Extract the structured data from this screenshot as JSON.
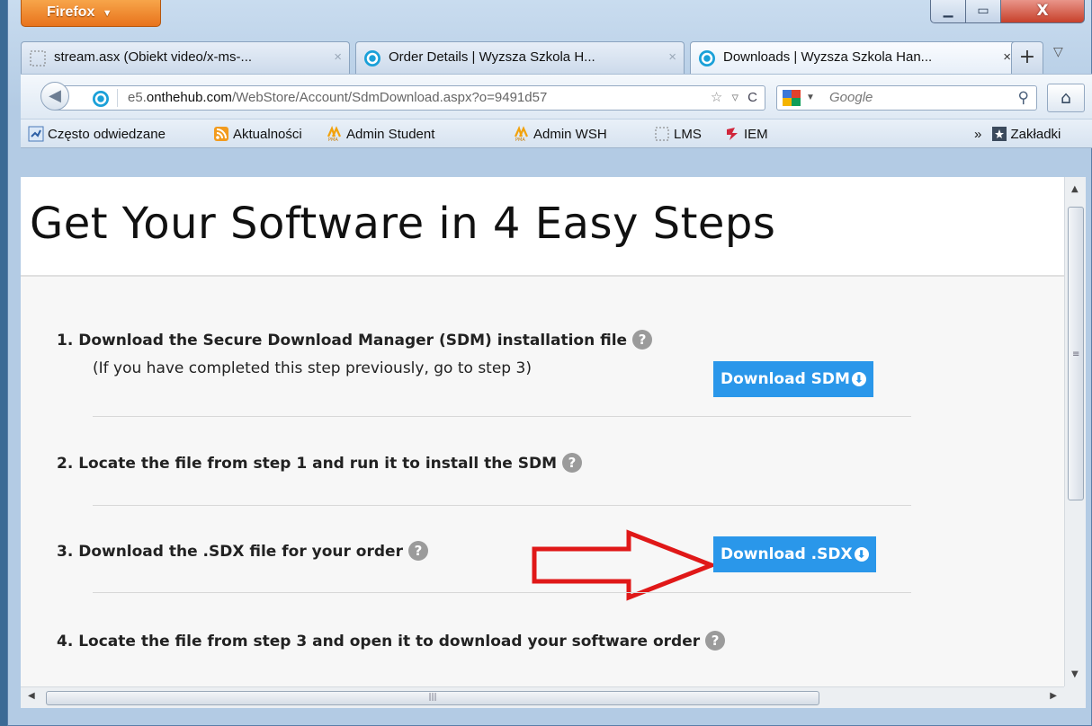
{
  "browser": {
    "app_button": "Firefox",
    "tabs": [
      {
        "label": "stream.asx (Obiekt video/x-ms-...",
        "close": "×"
      },
      {
        "label": "Order Details | Wyzsza Szkola H...",
        "close": "×"
      },
      {
        "label": "Downloads | Wyzsza Szkola Han...",
        "close": "×"
      }
    ],
    "new_tab": "+",
    "url": {
      "prefix": "e5.",
      "domain": "onthehub.com",
      "path": "/WebStore/Account/SdmDownload.aspx?o=9491d57"
    },
    "search_placeholder": "Google",
    "bookmarks": [
      "Często odwiedzane",
      "Aktualności",
      "Admin Student",
      "Admin WSH",
      "LMS",
      "IEM"
    ],
    "bookmarks_more": "»",
    "bookmarks_menu": "Zakładki"
  },
  "page": {
    "title": "Get Your Software in 4 Easy Steps",
    "steps": [
      {
        "text": "1. Download the Secure Download Manager (SDM) installation file",
        "help": "?"
      },
      {
        "text": "2. Locate the file from step 1 and run it to install the SDM",
        "help": "?"
      },
      {
        "text": "3. Download the .SDX file for your order",
        "help": "?"
      },
      {
        "text": "4. Locate the file from step 3 and open it to download your software order",
        "help": "?"
      }
    ],
    "step1_note": "(If you have completed this step previously, go to step 3)",
    "download_sdm": "Download SDM",
    "download_sdx": "Download .SDX"
  },
  "colors": {
    "button_blue": "#2a97ea",
    "arrow_red": "#e01818",
    "firefox_orange": "#e8731c"
  }
}
